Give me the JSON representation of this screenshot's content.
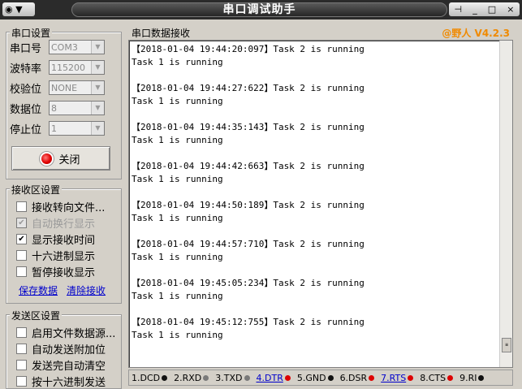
{
  "titlebar": {
    "title": "串口调试助手",
    "sysmenu": "▼",
    "pin": "⊣",
    "minimize": "_",
    "maximize": "□",
    "close": "×"
  },
  "serial_settings": {
    "legend": "串口设置",
    "fields": [
      {
        "label": "串口号",
        "value": "COM3"
      },
      {
        "label": "波特率",
        "value": "115200"
      },
      {
        "label": "校验位",
        "value": "NONE"
      },
      {
        "label": "数据位",
        "value": "8"
      },
      {
        "label": "停止位",
        "value": "1"
      }
    ],
    "close_button": "关闭"
  },
  "receive_settings": {
    "legend": "接收区设置",
    "options": [
      {
        "label": "接收转向文件...",
        "checked": false,
        "disabled": false
      },
      {
        "label": "自动换行显示",
        "checked": true,
        "disabled": true
      },
      {
        "label": "显示接收时间",
        "checked": true,
        "disabled": false
      },
      {
        "label": "十六进制显示",
        "checked": false,
        "disabled": false
      },
      {
        "label": "暂停接收显示",
        "checked": false,
        "disabled": false
      }
    ],
    "save_link": "保存数据",
    "clear_link": "清除接收"
  },
  "send_settings": {
    "legend": "发送区设置",
    "options": [
      {
        "label": "启用文件数据源...",
        "checked": false
      },
      {
        "label": "自动发送附加位",
        "checked": false
      },
      {
        "label": "发送完自动清空",
        "checked": false
      },
      {
        "label": "按十六进制发送",
        "checked": false
      }
    ]
  },
  "receive_area": {
    "legend": "串口数据接收",
    "brand": "@野人 V4.2.3",
    "entries": [
      {
        "timestamp": "【2018-01-04 19:44:20:097】Task 2 is running",
        "line2": "Task 1 is running"
      },
      {
        "timestamp": "【2018-01-04 19:44:27:622】Task 2 is running",
        "line2": "Task 1 is running"
      },
      {
        "timestamp": "【2018-01-04 19:44:35:143】Task 2 is running",
        "line2": "Task 1 is running"
      },
      {
        "timestamp": "【2018-01-04 19:44:42:663】Task 2 is running",
        "line2": "Task 1 is running"
      },
      {
        "timestamp": "【2018-01-04 19:44:50:189】Task 2 is running",
        "line2": "Task 1 is running"
      },
      {
        "timestamp": "【2018-01-04 19:44:57:710】Task 2 is running",
        "line2": "Task 1 is running"
      },
      {
        "timestamp": "【2018-01-04 19:45:05:234】Task 2 is running",
        "line2": "Task 1 is running"
      },
      {
        "timestamp": "【2018-01-04 19:45:12:755】Task 2 is running",
        "line2": "Task 1 is running"
      }
    ]
  },
  "status_signals": [
    {
      "label": "1.DCD",
      "color": "#111111",
      "link": false
    },
    {
      "label": "2.RXD",
      "color": "#7a7a7a",
      "link": false
    },
    {
      "label": "3.TXD",
      "color": "#7a7a7a",
      "link": false
    },
    {
      "label": "4.DTR",
      "color": "#dd0000",
      "link": true
    },
    {
      "label": "5.GND",
      "color": "#111111",
      "link": false
    },
    {
      "label": "6.DSR",
      "color": "#dd0000",
      "link": false
    },
    {
      "label": "7.RTS",
      "color": "#dd0000",
      "link": true
    },
    {
      "label": "8.CTS",
      "color": "#dd0000",
      "link": false
    },
    {
      "label": "9.RI",
      "color": "#111111",
      "link": false
    }
  ]
}
